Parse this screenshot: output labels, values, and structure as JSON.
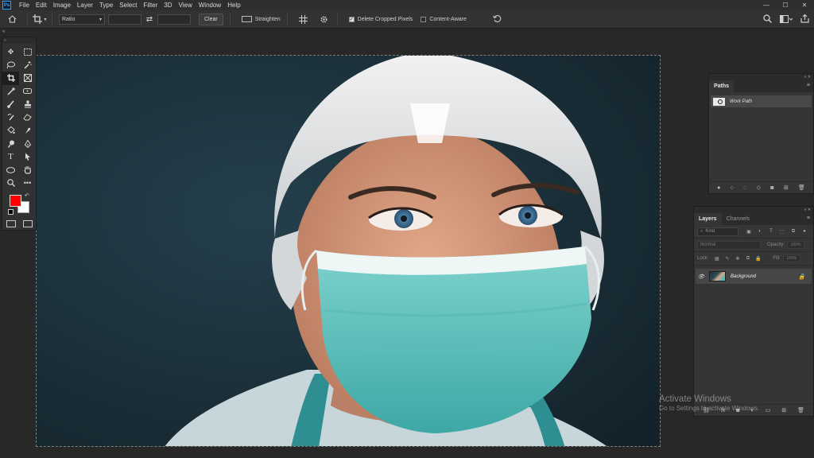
{
  "app": {
    "name": "Photoshop",
    "logo_text": "Ps"
  },
  "menu": [
    "File",
    "Edit",
    "Image",
    "Layer",
    "Type",
    "Select",
    "Filter",
    "3D",
    "View",
    "Window",
    "Help"
  ],
  "window_controls": {
    "minimize": "—",
    "maximize": "☐",
    "close": "✕"
  },
  "options_bar": {
    "ratio_select": "Ratio",
    "clear_label": "Clear",
    "straighten_label": "Straighten",
    "delete_cropped_label": "Delete Cropped Pixels",
    "delete_cropped_checked": true,
    "content_aware_label": "Content-Aware",
    "content_aware_checked": false
  },
  "toolbar": {
    "tools": [
      "move",
      "marquee",
      "lasso",
      "magic-wand",
      "crop",
      "frame",
      "eyedropper",
      "spot-healing",
      "brush",
      "clone-stamp",
      "history-brush",
      "eraser",
      "paint-bucket",
      "smudge",
      "dodge",
      "pen",
      "type",
      "path-selection",
      "ellipse",
      "hand",
      "zoom",
      "more"
    ],
    "active_tool": "crop",
    "foreground_color": "#ff0000",
    "background_color": "#ffffff"
  },
  "paths_panel": {
    "tab": "Paths",
    "items": [
      {
        "name": "Work Path"
      }
    ]
  },
  "layers_panel": {
    "tabs": [
      "Layers",
      "Channels"
    ],
    "active_tab": "Layers",
    "filter_placeholder": "Kind",
    "blend_mode": "Normal",
    "opacity_label": "Opacity:",
    "opacity_value": "100%",
    "lock_label": "Lock:",
    "fill_label": "Fill:",
    "fill_value": "100%",
    "layers": [
      {
        "name": "Background",
        "visible": true,
        "locked": true
      }
    ]
  },
  "watermark": {
    "title": "Activate Windows",
    "subtitle": "Go to Settings to activate Windows."
  },
  "colors": {
    "accent_blue": "#31a8ff",
    "mask_teal": "#4fb9b3",
    "photo_background": "#1c2e37"
  }
}
